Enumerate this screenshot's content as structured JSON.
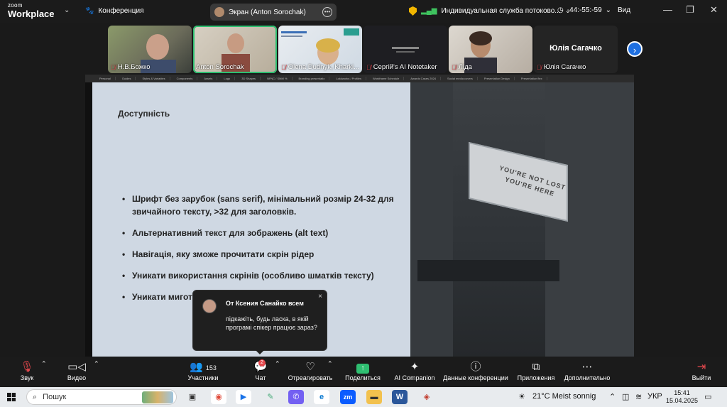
{
  "topbar": {
    "logo_small": "zoom",
    "logo_big": "Workplace",
    "conference_label": "Конференция",
    "screen_share_label": "Экран (Anton Sorochak)",
    "service_label": "Индивидуальная служба потоково...",
    "timer": "-44:-55:-59",
    "view_label": "Вид",
    "icons": [
      "chevron-down-icon",
      "paw-icon",
      "shield-icon",
      "signal-icon",
      "clock-icon",
      "minimize-icon",
      "restore-icon",
      "close-icon"
    ]
  },
  "participants": [
    {
      "name": "Н.В.Божко",
      "muted": true
    },
    {
      "name": "Anton Sorochak",
      "muted": false,
      "active": true
    },
    {
      "name": "Olena Dudnyk, Kharki...",
      "muted": true
    },
    {
      "name": "Сергій's AI Notetaker",
      "muted": true
    },
    {
      "name": "Ліда",
      "muted": true
    },
    {
      "name": "Юлія Сагачко",
      "muted": true,
      "big_label": "Юлія Сагачко"
    }
  ],
  "slide": {
    "browser_tabs": [
      "Personal",
      "Guides",
      "Styles & Variables",
      "Components",
      "Assets",
      "Logo",
      "3D Shapes",
      "NFNC / SMM %",
      "Branding presentatio",
      "Lokkworks / Profiles",
      "Workframe Schedule",
      "Awards Cases 2024",
      "Social media covers",
      "Presentation Design",
      "Presentation flex"
    ],
    "heading": "Доступність",
    "bullets": [
      "Шрифт без зарубок (sans serif), мінімальний розмір 24-32 для звичайного тексту, >32 для заголовків.",
      "Альтернативний текст для зображень (alt text)",
      "Навігація, яку зможе прочитати скрін рідер",
      "Уникати використання скрінів (особливо шматків тексту)",
      "Уникати мигот"
    ],
    "sign_text_line1": "YOU'RE NOT LOST",
    "sign_text_line2": "YOU'RE HERE"
  },
  "chat_popup": {
    "from": "От Ксения Санайко всем",
    "message": "підкажіть, будь ласка, в якій програмі спікер працює зараз?",
    "close": "×"
  },
  "toolbar": {
    "audio": "Звук",
    "video": "Видео",
    "participants": "Участники",
    "participants_count": "153",
    "chat": "Чат",
    "chat_badge": "2",
    "react": "Отреагировать",
    "share": "Поделиться",
    "ai": "AI Companion",
    "info": "Данные конференции",
    "apps": "Приложения",
    "more": "Дополнительно",
    "exit": "Выйти"
  },
  "taskbar": {
    "search_placeholder": "Пошук",
    "weather": "21°C  Meist sonnig",
    "language": "УКР",
    "time": "15:41",
    "date": "15.04.2025"
  }
}
